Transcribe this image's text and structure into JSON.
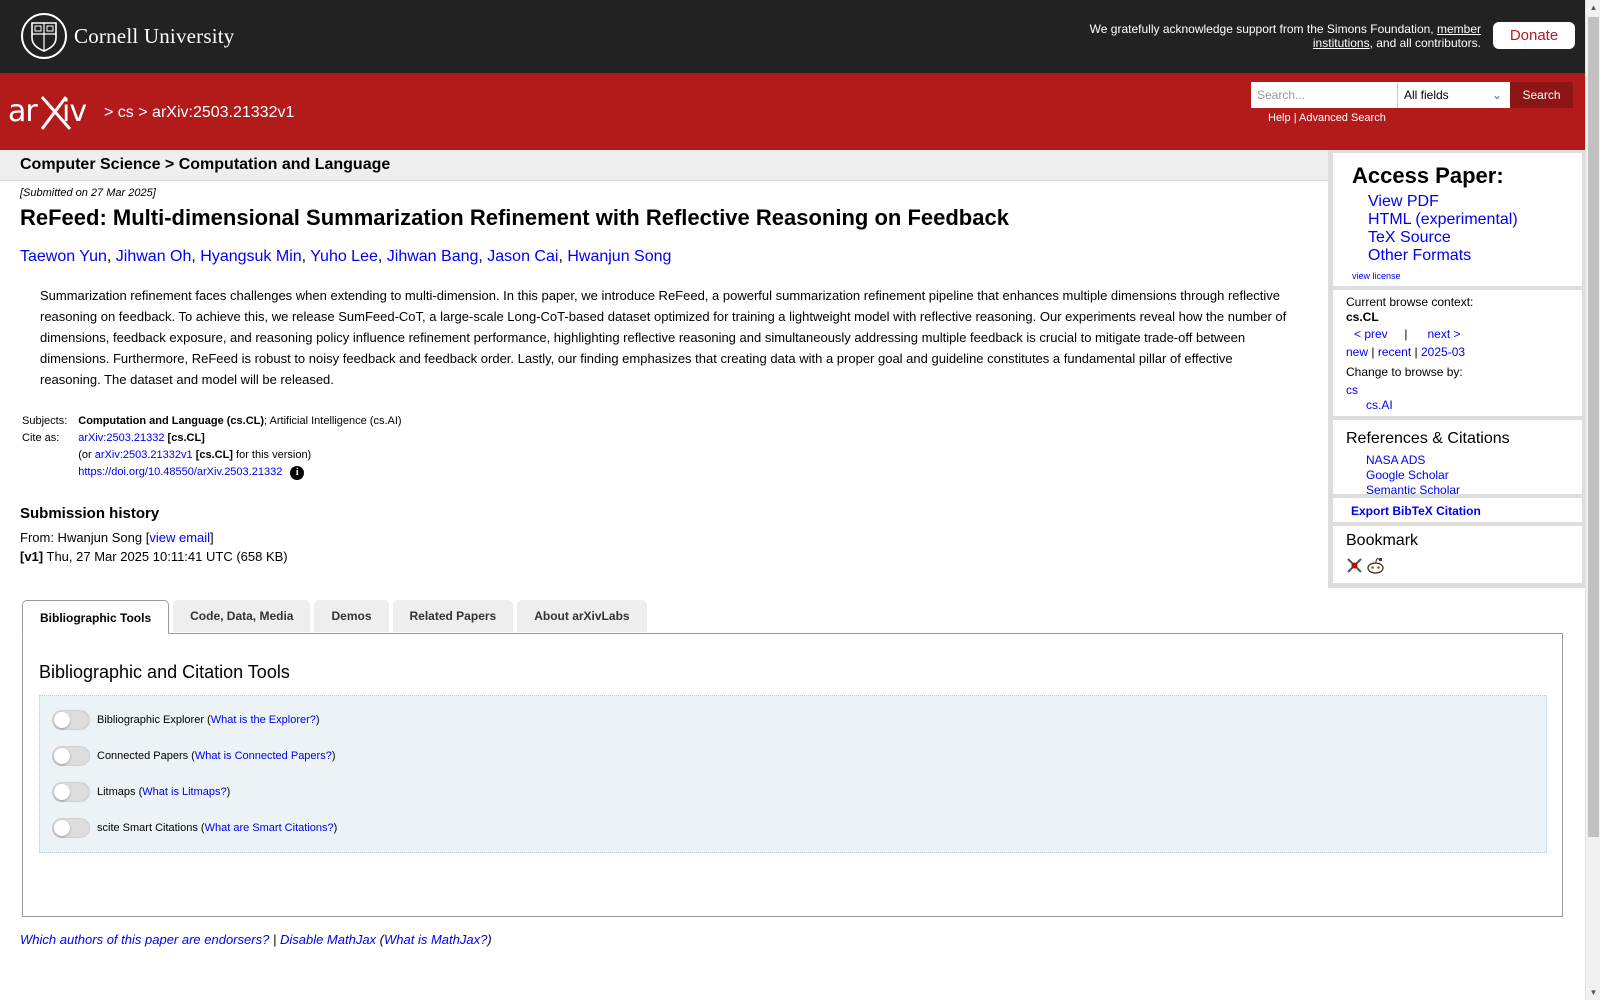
{
  "topbar": {
    "university": "Cornell University",
    "support_prefix": "We gratefully acknowledge support from the Simons Foundation,",
    "support_link": "member institutions",
    "support_suffix": ", and all contributors.",
    "donate": "Donate"
  },
  "header": {
    "logo": "arXiv",
    "crumb_sep1": ">",
    "crumb_cs": "cs",
    "crumb_sep2": ">",
    "crumb_id": "arXiv:2503.21332v1",
    "search_placeholder": "Search...",
    "search_field": "All fields",
    "search_button": "Search",
    "help": "Help",
    "link_sep": "|",
    "advanced": "Advanced Search"
  },
  "category": "Computer Science > Computation and Language",
  "paper": {
    "submitted": "[Submitted on 27 Mar 2025]",
    "title": "ReFeed: Multi-dimensional Summarization Refinement with Reflective Reasoning on Feedback",
    "authors": [
      "Taewon Yun",
      "Jihwan Oh",
      "Hyangsuk Min",
      "Yuho Lee",
      "Jihwan Bang",
      "Jason Cai",
      "Hwanjun Song"
    ],
    "abstract": "Summarization refinement faces challenges when extending to multi-dimension. In this paper, we introduce ReFeed, a powerful summarization refinement pipeline that enhances multiple dimensions through reflective reasoning on feedback. To achieve this, we release SumFeed-CoT, a large-scale Long-CoT-based dataset optimized for training a lightweight model with reflective reasoning. Our experiments reveal how the number of dimensions, feedback exposure, and reasoning policy influence refinement performance, highlighting reflective reasoning and simultaneously addressing multiple feedback is crucial to mitigate trade-off between dimensions. Furthermore, ReFeed is robust to noisy feedback and feedback order. Lastly, our finding emphasizes that creating data with a proper goal and guideline constitutes a fundamental pillar of effective reasoning. The dataset and model will be released.",
    "subjects_label": "Subjects:",
    "subjects_primary": "Computation and Language (cs.CL)",
    "subjects_rest": "; Artificial Intelligence (cs.AI)",
    "cite_label": "Cite as:",
    "cite_id": "arXiv:2503.21332",
    "cite_cat": "[cs.CL]",
    "cite_v_prefix": "(or",
    "cite_v_id": "arXiv:2503.21332v1",
    "cite_v_cat": "[cs.CL]",
    "cite_v_suffix": "for this version)",
    "doi": "https://doi.org/10.48550/arXiv.2503.21332",
    "history_heading": "Submission history",
    "from_label": "From: Hwanjun Song [",
    "view_email": "view email",
    "from_close": "]",
    "version_tag": "[v1]",
    "version_info": "Thu, 27 Mar 2025 10:11:41 UTC (658 KB)"
  },
  "sidebar": {
    "access_heading": "Access Paper:",
    "access_links": [
      "View PDF",
      "HTML (experimental)",
      "TeX Source",
      "Other Formats"
    ],
    "view_license": "view license",
    "context_label": "Current browse context:",
    "context_value": "cs.CL",
    "prev": "< prev",
    "pipe": "|",
    "next": "next >",
    "new": "new",
    "recent": "recent",
    "month": "2025-03",
    "change_label": "Change to browse by:",
    "browse_cs": "cs",
    "browse_csai": "cs.AI",
    "refs_heading": "References & Citations",
    "refs_links": [
      "NASA ADS",
      "Google Scholar",
      "Semantic Scholar"
    ],
    "export_bibtex": "Export BibTeX Citation",
    "bookmark_heading": "Bookmark"
  },
  "tabs": [
    "Bibliographic Tools",
    "Code, Data, Media",
    "Demos",
    "Related Papers",
    "About arXivLabs"
  ],
  "tools": {
    "heading": "Bibliographic and Citation Tools",
    "items": [
      {
        "label": "Bibliographic Explorer",
        "link": "What is the Explorer?"
      },
      {
        "label": "Connected Papers",
        "link": "What is Connected Papers?"
      },
      {
        "label": "Litmaps",
        "link": "What is Litmaps?"
      },
      {
        "label": "scite Smart Citations",
        "link": "What are Smart Citations?"
      }
    ]
  },
  "footer": {
    "endorsers": "Which authors of this paper are endorsers?",
    "sep": "|",
    "disable_mathjax": "Disable MathJax",
    "what_mathjax": "What is MathJax?"
  }
}
